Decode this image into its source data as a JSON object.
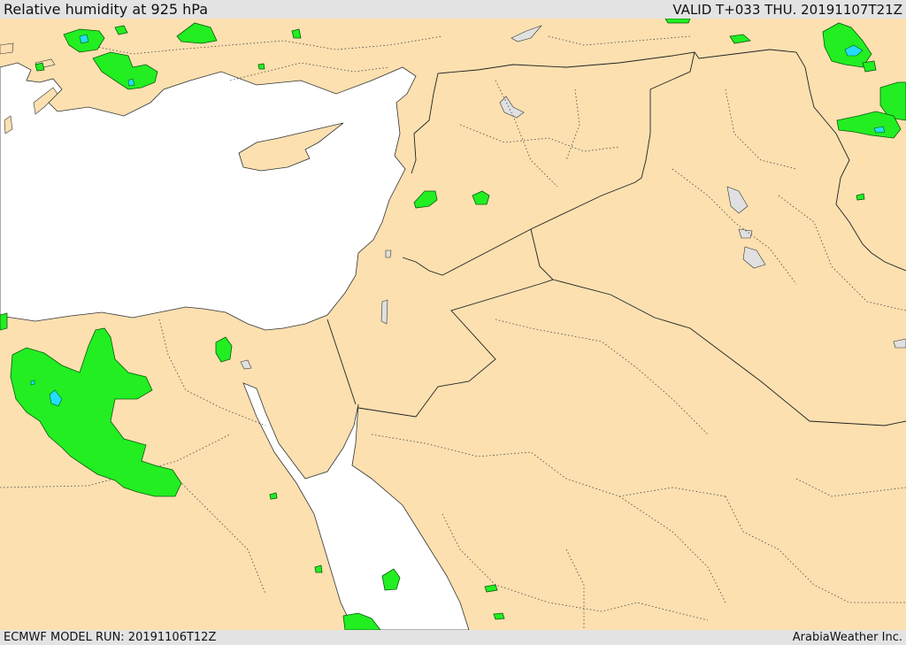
{
  "header": {
    "title": "Relative humidity at 925 hPa",
    "valid": "VALID T+033 THU. 20191107T21Z"
  },
  "footer": {
    "model_run": "ECMWF MODEL RUN: 20191106T12Z",
    "credit": "ArabiaWeather Inc."
  },
  "colors": {
    "land": "#fce0b0",
    "sea": "#ffffff",
    "lake": "#e0e0e0",
    "humid_high": "#22ee22",
    "humid_very_high": "#22ddff",
    "border": "#222222",
    "bar": "#e3e3e3"
  }
}
